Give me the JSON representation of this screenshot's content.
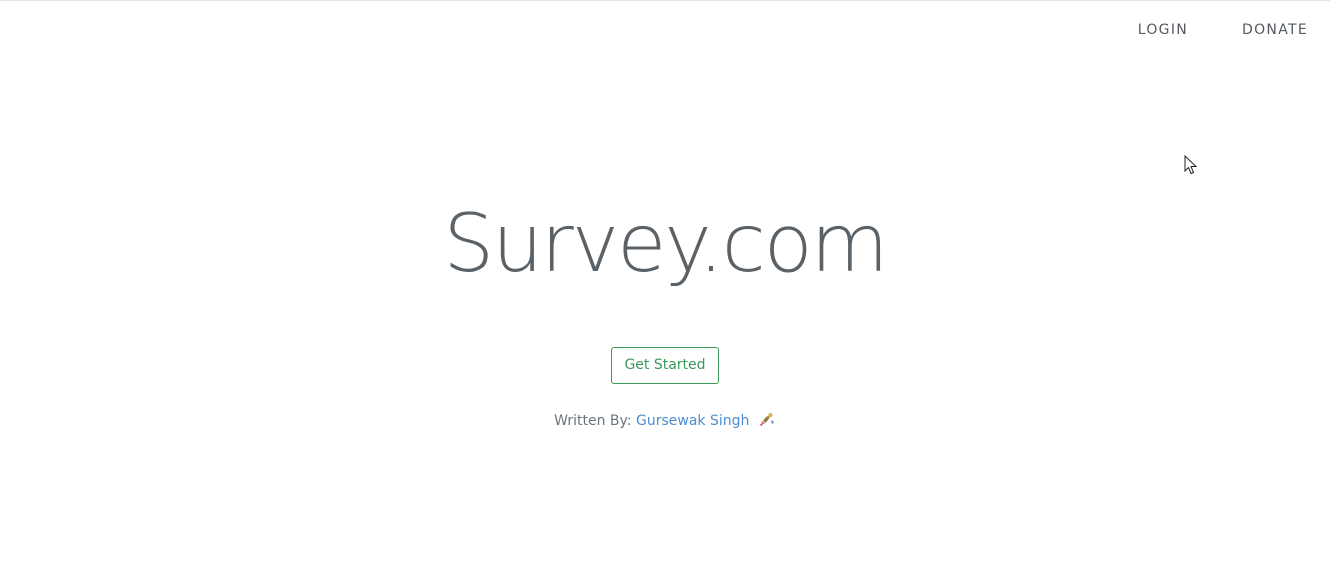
{
  "nav": {
    "login_label": "LOGIN",
    "donate_label": "DONATE"
  },
  "hero": {
    "title": "Survey.com",
    "cta_label": "Get Started"
  },
  "credit": {
    "prefix": "Written By:",
    "author": "Gursewak Singh",
    "emoji_icon": "rocket-person-icon"
  },
  "colors": {
    "title": "#5a6268",
    "cta": "#3a9a58",
    "link": "#4b8dd0",
    "nav": "#545a5f"
  }
}
